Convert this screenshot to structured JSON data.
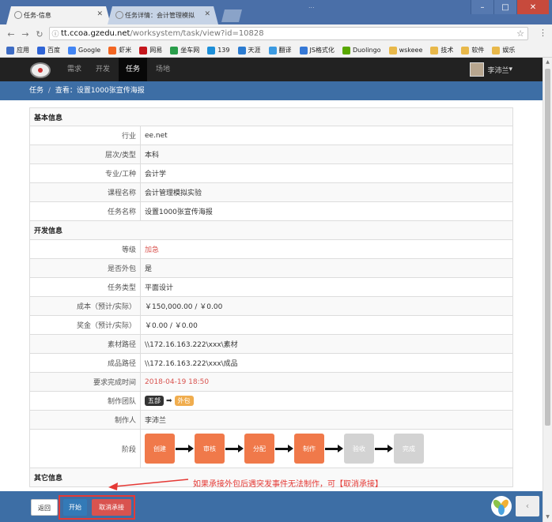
{
  "browser": {
    "tabs": [
      {
        "title": "任务-信息",
        "active": true
      },
      {
        "title": "任务详情：会计管理模拟",
        "active": false
      }
    ],
    "background_title": "...",
    "url_host": "tt.ccoa.gzedu.net",
    "url_path": "/worksystem/task/view?id=10828",
    "bookmarks": [
      "应用",
      "百度",
      "Google",
      "虾米",
      "网易",
      "坐车网",
      "139",
      "天涯",
      "翻译",
      "JS格式化",
      "Duolingo",
      "wskeee",
      "技术",
      "软件",
      "娱乐"
    ]
  },
  "nav": {
    "items": [
      "需求",
      "开发",
      "任务",
      "场地"
    ],
    "active": "任务",
    "user_name": "李沛兰"
  },
  "breadcrumb": {
    "root": "任务",
    "sep": "/",
    "current": "查看：设置1000张宣传海报"
  },
  "basic_section": "基本信息",
  "basic": [
    {
      "label": "行业",
      "value": "ee.net"
    },
    {
      "label": "层次/类型",
      "value": "本科"
    },
    {
      "label": "专业/工种",
      "value": "会计学"
    },
    {
      "label": "课程名称",
      "value": "会计管理模拟实验"
    },
    {
      "label": "任务名称",
      "value": "设置1000张宣传海报"
    }
  ],
  "dev_section": "开发信息",
  "dev": [
    {
      "label": "等级",
      "value": "加急"
    },
    {
      "label": "是否外包",
      "value": "是"
    },
    {
      "label": "任务类型",
      "value": "平面设计"
    },
    {
      "label": "成本（预计/实际）",
      "value": "￥150,000.00 / ￥0.00"
    },
    {
      "label": "奖金（预计/实际）",
      "value": "￥0.00 / ￥0.00"
    },
    {
      "label": "素材路径",
      "value": "\\\\172.16.163.222\\xxx\\素材"
    },
    {
      "label": "成品路径",
      "value": "\\\\172.16.163.222\\xxx\\成品"
    },
    {
      "label": "要求完成时间",
      "value": "2018-04-19 18:50"
    }
  ],
  "team": {
    "label": "制作团队",
    "from": "五部",
    "to": "外包"
  },
  "creator": {
    "label": "制作人",
    "value": "李沛兰"
  },
  "stage": {
    "label": "阶段",
    "steps": [
      {
        "name": "创建",
        "done": true
      },
      {
        "name": "审核",
        "done": true
      },
      {
        "name": "分配",
        "done": true
      },
      {
        "name": "制作",
        "done": true
      },
      {
        "name": "验收",
        "done": false
      },
      {
        "name": "完成",
        "done": false
      }
    ]
  },
  "other_section": "其它信息",
  "annotation": "如果承接外包后遇突发事件无法制作，可【取消承接】",
  "footer": {
    "back": "返回",
    "start": "开始",
    "cancel": "取消承接"
  },
  "colors": {
    "nav_bg": "#222222",
    "breadcrumb_bg": "#3d6ea5",
    "stage_done": "#f0794a",
    "stage_todo": "#d3d3d3",
    "annotation": "#e53935",
    "danger": "#d9534f",
    "primary": "#337ab7"
  }
}
